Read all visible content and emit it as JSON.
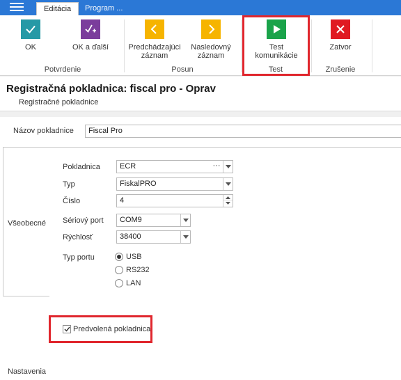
{
  "tabs": [
    "Editácia",
    "Program ..."
  ],
  "ribbon": {
    "ok": "OK",
    "ok_next": "OK a ďalší",
    "prev_line1": "Predchádzajúci",
    "prev_line2": "záznam",
    "next_line1": "Nasledovný",
    "next_line2": "záznam",
    "test_line1": "Test",
    "test_line2": "komunikácie",
    "close": "Zatvor",
    "groups": {
      "confirm": "Potvrdenie",
      "move": "Posun",
      "test": "Test",
      "cancel": "Zrušenie"
    }
  },
  "header": {
    "title": "Registračná pokladnica: fiscal pro - Oprav",
    "subtitle": "Registračné pokladnice"
  },
  "form": {
    "name_label": "Názov pokladnice",
    "name_value": "Fiscal Pro",
    "section_general": "Všeobecné",
    "section_settings": "Nastavenia",
    "register_label": "Pokladnica",
    "register_value": "ECR",
    "register_dots": "···",
    "type_label": "Typ",
    "type_value": "FiskalPRO",
    "number_label": "Číslo",
    "number_value": "4",
    "serial_label": "Sériový port",
    "serial_value": "COM9",
    "speed_label": "Rýchlosť",
    "speed_value": "38400",
    "port_type_label": "Typ portu",
    "port_options": [
      "USB",
      "RS232",
      "LAN"
    ],
    "port_selected": "USB",
    "default_register": "Predvolená pokladnica",
    "default_checked": true
  },
  "colors": {
    "tabbar": "#2b78d6",
    "highlight": "#e0262d"
  }
}
